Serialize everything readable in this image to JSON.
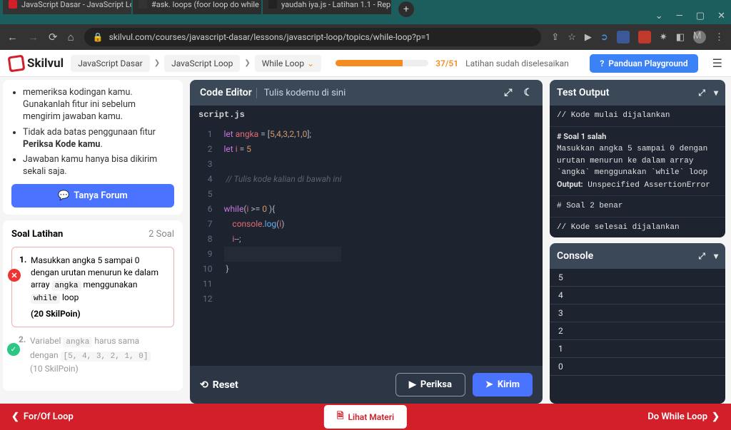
{
  "browser": {
    "tabs": [
      {
        "title": "JavaScript Dasar - JavaScript Loo",
        "favicon": "#d21f2a"
      },
      {
        "title": "#ask. loops (foor loop do while l",
        "favicon": "#3b82f6"
      },
      {
        "title": "yaudah iya.js - Latihan 1.1 - Rep",
        "favicon": "#222"
      }
    ],
    "url": "skilvul.com/courses/javascript-dasar/lessons/javascript-loop/topics/while-loop?p=1"
  },
  "header": {
    "logo": "Skilvul",
    "breadcrumb": [
      "JavaScript Dasar",
      "JavaScript Loop",
      "While Loop"
    ],
    "progress_value": 72,
    "progress_text": "37/51",
    "progress_label": "Latihan sudah diselesaikan",
    "panduan": "Panduan Playground"
  },
  "left": {
    "tips": [
      "memeriksa kodingan kamu. Gunakanlah fitur ini sebelum mengirim jawaban kamu.",
      "Tidak ada batas penggunaan fitur <b>Periksa Kode kamu</b>.",
      "Jawaban kamu hanya bisa dikirim sekali saja."
    ],
    "forum_btn": "Tanya Forum",
    "soal_title": "Soal Latihan",
    "soal_count": "2 Soal",
    "soal1_num": "1.",
    "soal1_text": "Masukkan angka 5 sampai 0 dengan urutan menurun ke dalam array <code>angka</code> menggunakan <code>while</code> loop",
    "soal1_pts": "(20 SkilPoin)",
    "soal2_num": "2.",
    "soal2_text": "Variabel <code>angka</code> harus sama dengan <code>[5, 4, 3, 2, 1, 0]</code>",
    "soal2_pts": "(10 SkilPoin)"
  },
  "editor": {
    "title": "Code Editor",
    "subtitle": "Tulis kodemu di sini",
    "file": "script.js",
    "lines": [
      "let angka = [5,4,3,2,1,0];",
      "let i = 5",
      "",
      " // Tulis kode kalian di bawah ini",
      "",
      "while(i >= 0 ){",
      "    console.log(i)",
      "    i--;",
      "",
      " }",
      "",
      ""
    ],
    "reset": "Reset",
    "periksa": "Periksa",
    "kirim": "Kirim"
  },
  "test_output": {
    "title": "Test Output",
    "block1": "// Kode mulai dijalankan",
    "block2": "# Soal 1 salah\nMasukkan angka 5 sampai 0 dengan urutan menurun ke dalam array `angka` menggunakan `while` loop\nOutput: Unspecified AssertionError",
    "block3": "# Soal 2 benar",
    "block4": "// Kode selesai dijalankan"
  },
  "console": {
    "title": "Console",
    "lines": [
      "5",
      "4",
      "3",
      "2",
      "1",
      "0"
    ]
  },
  "bottom": {
    "prev": "For/Of Loop",
    "center": "Lihat Materi",
    "next": "Do While Loop"
  }
}
